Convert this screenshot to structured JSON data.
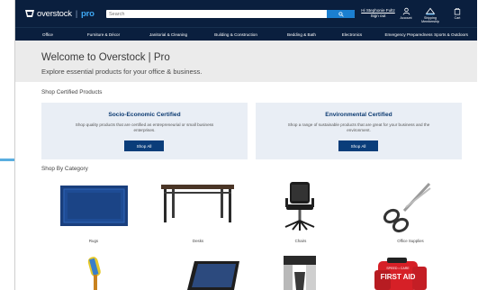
{
  "header": {
    "logo_text": "overstock",
    "logo_separator": "|",
    "logo_pro": "pro",
    "search": {
      "placeholder": "Search"
    },
    "account": {
      "greeting": "Hi Stephonie Fultz",
      "sign_out": "Sign out"
    },
    "icons": [
      {
        "name": "account",
        "label": "Account"
      },
      {
        "name": "shipping",
        "label": "Shipping Membership"
      },
      {
        "name": "cart",
        "label": "Cart"
      }
    ]
  },
  "nav": {
    "items": [
      "Office",
      "Furniture & Décor",
      "Janitorial & Cleaning",
      "Building & Construction",
      "Bedding & Bath",
      "Electronics",
      "Emergency Preparedness",
      "Sports & Outdoors"
    ]
  },
  "hero": {
    "title": "Welcome to Overstock | Pro",
    "subtitle": "Explore essential products for your office & business."
  },
  "certified": {
    "section_title": "Shop Certified Products",
    "cards": [
      {
        "title": "Socio-Economic Certified",
        "description": "Shop quality products that are certified as entrepreneurial or small business enterprises.",
        "button": "Shop All"
      },
      {
        "title": "Environmental Certified",
        "description": "Shop a range of sustainable products that are great for your business and the environment.",
        "button": "Shop All"
      }
    ]
  },
  "categories": {
    "section_title": "Shop By Category",
    "items": [
      {
        "label": "Rugs",
        "icon": "rug-image"
      },
      {
        "label": "Desks",
        "icon": "desk-image"
      },
      {
        "label": "Chairs",
        "icon": "chair-image"
      },
      {
        "label": "Office Supplies",
        "icon": "scissors-image"
      },
      {
        "label": "",
        "icon": "cleaning-brush-image"
      },
      {
        "label": "",
        "icon": "laptop-image"
      },
      {
        "label": "",
        "icon": "coffee-maker-image"
      },
      {
        "label": "",
        "icon": "first-aid-kit-image"
      }
    ],
    "first_aid_text": "FIRST AID",
    "first_aid_small": "SPEED • CARE"
  },
  "colors": {
    "header_bg": "#0a1f3e",
    "accent_blue": "#1b7fd1",
    "logo_pro": "#3fa9f5",
    "button_bg": "#0a3d7a",
    "card_bg": "#e9eef5",
    "hero_bg": "#ebebeb"
  }
}
